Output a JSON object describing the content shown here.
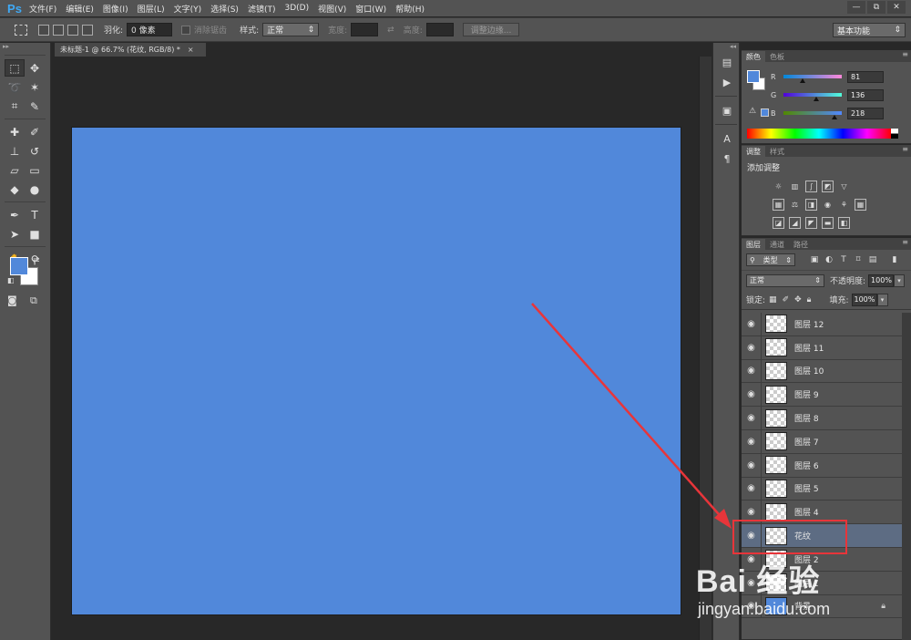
{
  "app": {
    "logo": "Ps"
  },
  "menu": [
    "文件(F)",
    "编辑(E)",
    "图像(I)",
    "图层(L)",
    "文字(Y)",
    "选择(S)",
    "滤镜(T)",
    "3D(D)",
    "视图(V)",
    "窗口(W)",
    "帮助(H)"
  ],
  "window_buttons": [
    "—",
    "⧉",
    "✕"
  ],
  "options": {
    "feather_label": "羽化:",
    "feather_value": "0 像素",
    "antialias_label": "消除锯齿",
    "style_label": "样式:",
    "style_value": "正常",
    "width_label": "宽度:",
    "height_label": "高度:",
    "refine_edge": "调整边缘...",
    "workspace": "基本功能"
  },
  "document": {
    "tab_title": "未标题-1 @ 66.7% (花纹, RGB/8) *",
    "close": "×",
    "canvas_color": "#5188da"
  },
  "color_panel": {
    "tabs": [
      "颜色",
      "色板"
    ],
    "r_label": "R",
    "g_label": "G",
    "b_label": "B",
    "r_value": "81",
    "g_value": "136",
    "b_value": "218",
    "fg": "#5188da",
    "bg": "#ffffff"
  },
  "adjust_panel": {
    "tabs": [
      "调整",
      "样式"
    ],
    "title": "添加调整"
  },
  "layers_panel": {
    "tabs": [
      "图层",
      "通道",
      "路径"
    ],
    "filter_kind": "类型",
    "blend_mode": "正常",
    "opacity_label": "不透明度:",
    "opacity_value": "100%",
    "lock_label": "锁定:",
    "fill_label": "填充:",
    "fill_value": "100%",
    "layers": [
      {
        "name": "图层 12",
        "selected": false
      },
      {
        "name": "图层 11",
        "selected": false
      },
      {
        "name": "图层 10",
        "selected": false
      },
      {
        "name": "图层 9",
        "selected": false
      },
      {
        "name": "图层 8",
        "selected": false
      },
      {
        "name": "图层 7",
        "selected": false
      },
      {
        "name": "图层 6",
        "selected": false
      },
      {
        "name": "图层 5",
        "selected": false
      },
      {
        "name": "图层 4",
        "selected": false
      },
      {
        "name": "花纹",
        "selected": true
      },
      {
        "name": "图层 2",
        "selected": false
      },
      {
        "name": "图层 1",
        "selected": false
      },
      {
        "name": "背景",
        "selected": false,
        "locked": true,
        "solid": true
      }
    ]
  },
  "annotation": {
    "color": "#e8353a"
  },
  "watermark": {
    "main": "Bai 经验",
    "sub": "jingyan.baidu.com"
  }
}
